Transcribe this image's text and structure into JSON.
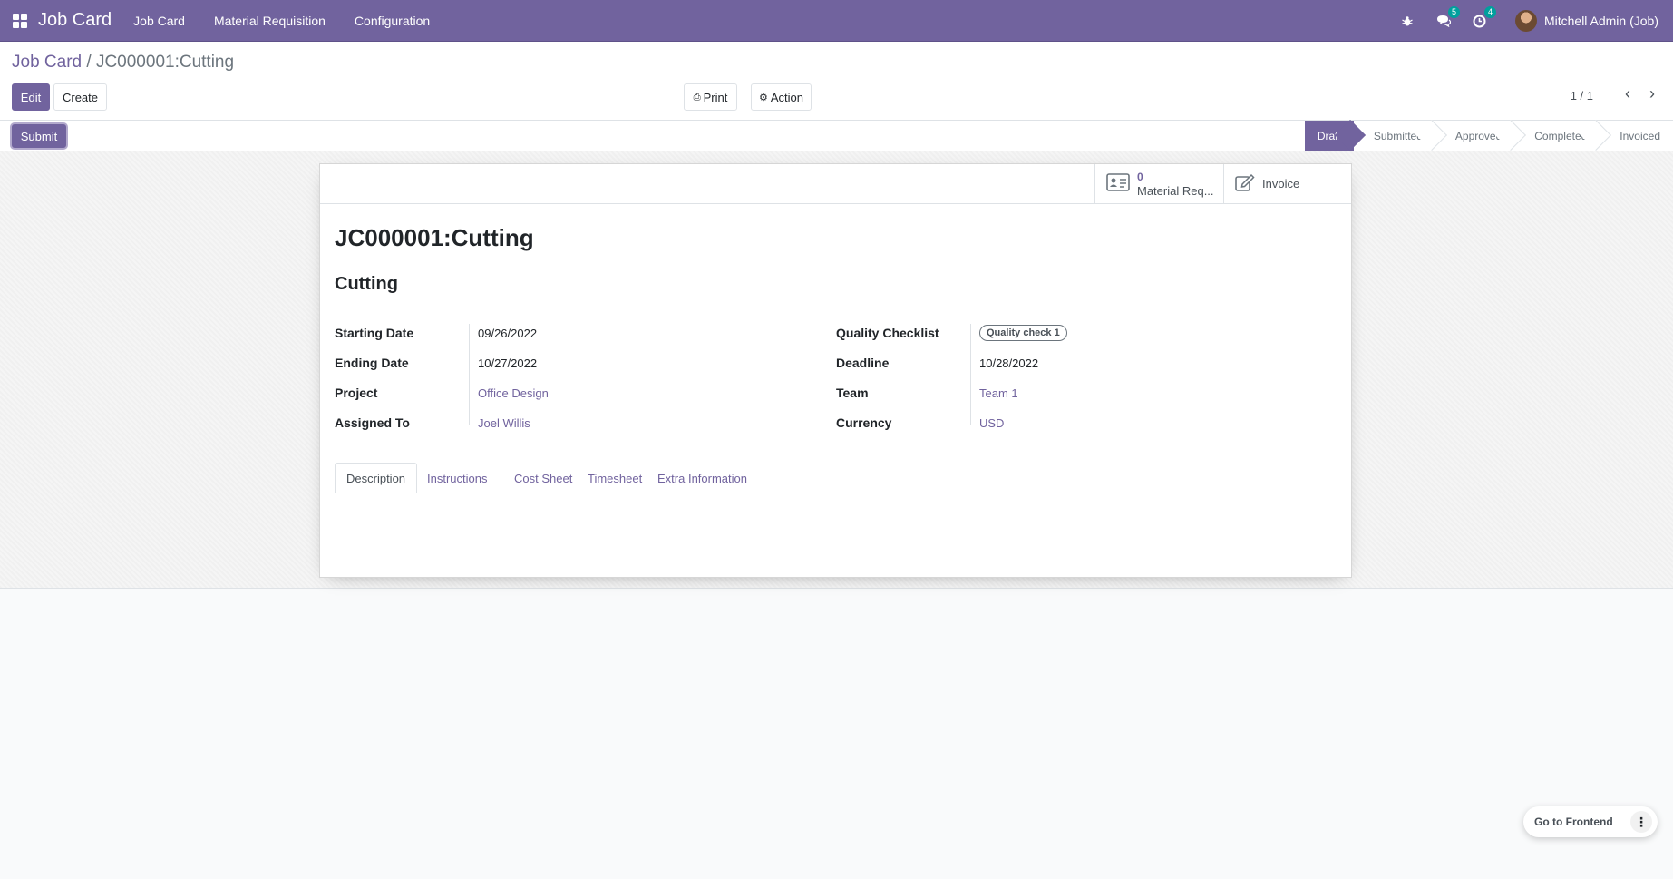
{
  "navbar": {
    "brand": "Job Card",
    "menu": [
      "Job Card",
      "Material Requisition",
      "Configuration"
    ],
    "messages_count": "5",
    "activities_count": "4",
    "user": "Mitchell Admin (Job)"
  },
  "breadcrumb": {
    "parent": "Job Card",
    "separator": "/",
    "current": "JC000001:Cutting"
  },
  "toolbar": {
    "edit": "Edit",
    "create": "Create",
    "print": "Print",
    "action": "Action"
  },
  "pager": {
    "value": "1 / 1"
  },
  "statusbar": {
    "submit": "Submit",
    "stages": [
      "Draft",
      "Submitted",
      "Approved",
      "Completed",
      "Invoiced"
    ],
    "active_stage": "Draft"
  },
  "smart_buttons": {
    "material_req_count": "0",
    "material_req_label": "Material Req...",
    "invoice_label": "Invoice"
  },
  "form": {
    "title": "JC000001:Cutting",
    "subtitle": "Cutting",
    "left": [
      {
        "label": "Starting Date",
        "value": "09/26/2022"
      },
      {
        "label": "Ending Date",
        "value": "10/27/2022"
      },
      {
        "label": "Project",
        "value": "Office Design"
      },
      {
        "label": "Assigned To",
        "value": "Joel Willis"
      }
    ],
    "right": [
      {
        "label": "Quality Checklist",
        "value": "Quality check 1"
      },
      {
        "label": "Deadline",
        "value": "10/28/2022"
      },
      {
        "label": "Team",
        "value": "Team 1"
      },
      {
        "label": "Currency",
        "value": "USD"
      }
    ],
    "tabs": [
      "Description",
      "Instructions",
      "Cost Sheet",
      "Timesheet",
      "Extra Information"
    ],
    "active_tab": "Description"
  },
  "frontend": {
    "label": "Go to Frontend"
  },
  "colors": {
    "brand": "#71639e",
    "badge": "#00a09d"
  }
}
